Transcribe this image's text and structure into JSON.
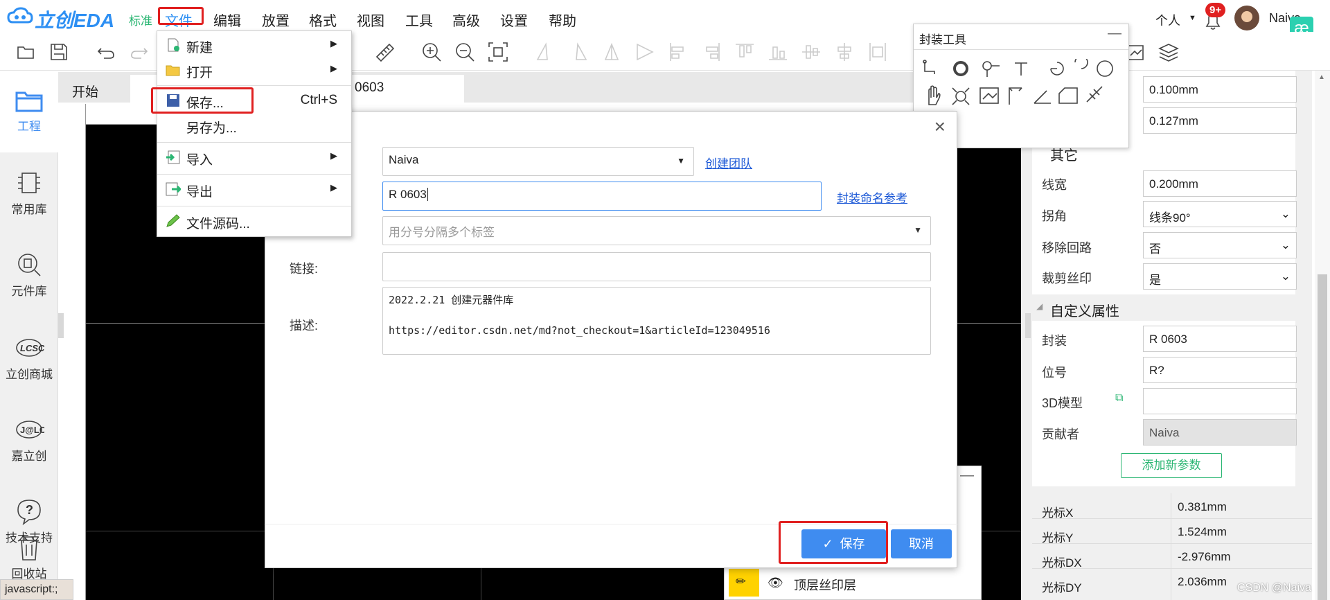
{
  "app": {
    "logo": "立创EDA",
    "edition": "标准",
    "user_menu": "个人",
    "notifications": "9+",
    "username": "Naiva"
  },
  "menu": [
    "文件",
    "编辑",
    "放置",
    "格式",
    "视图",
    "工具",
    "高级",
    "设置",
    "帮助"
  ],
  "sidebar": [
    {
      "label": "工程",
      "icon": "folder-icon"
    },
    {
      "label": "常用库",
      "icon": "chip-icon"
    },
    {
      "label": "元件库",
      "icon": "component-search-icon"
    },
    {
      "label": "立创商城",
      "icon": "lcsc-icon"
    },
    {
      "label": "嘉立创",
      "icon": "jlc-icon"
    },
    {
      "label": "技术支持",
      "icon": "help-icon"
    },
    {
      "label": "回收站",
      "icon": "trash-icon"
    }
  ],
  "tabs": {
    "start": "开始",
    "current": "0603"
  },
  "file_menu": {
    "new": "新建",
    "open": "打开",
    "save": "保存...",
    "save_shortcut": "Ctrl+S",
    "save_as": "另存为...",
    "import": "导入",
    "export": "导出",
    "source": "文件源码..."
  },
  "dialog": {
    "owner_value": "Naiva",
    "create_team": "创建团队",
    "name_value": "R 0603",
    "naming_ref": "封装命名参考",
    "tags_placeholder": "用分号分隔多个标签",
    "link_label": "链接:",
    "link_value": "",
    "desc_label": "描述:",
    "desc_line1": "2022.2.21 创建元器件库",
    "desc_line2": "https://editor.csdn.net/md?not_checkout=1&articleId=123049516",
    "save_button": "保存",
    "cancel_button": "取消"
  },
  "fp_tools": {
    "title": "封装工具"
  },
  "right_panel": {
    "fields_top": [
      "0.100mm",
      "0.127mm"
    ],
    "section_other": "其它",
    "linewidth_label": "线宽",
    "linewidth_value": "0.200mm",
    "corner_label": "拐角",
    "corner_value": "线条90°",
    "remove_loop_label": "移除回路",
    "remove_loop_value": "否",
    "clip_silk_label": "裁剪丝印",
    "clip_silk_value": "是",
    "section_custom": "自定义属性",
    "package_label": "封装",
    "package_value": "R 0603",
    "designator_label": "位号",
    "designator_value": "R?",
    "model3d_label": "3D模型",
    "model3d_value": "",
    "contributor_label": "贡献者",
    "contributor_value": "Naiva",
    "add_param_button": "添加新参数",
    "cursor": [
      {
        "label": "光标X",
        "value": "0.381mm"
      },
      {
        "label": "光标Y",
        "value": "1.524mm"
      },
      {
        "label": "光标DX",
        "value": "-2.976mm"
      },
      {
        "label": "光标DY",
        "value": "2.036mm"
      }
    ]
  },
  "layers": {
    "top_silk": "顶层丝印层"
  },
  "status_bar": "javascript:;",
  "watermark": "CSDN @Naiva",
  "colors": {
    "accent": "#3f8cf0",
    "highlight_red": "#e02020",
    "brand_blue": "#2d8ff3",
    "brand_green": "#2bb673"
  }
}
